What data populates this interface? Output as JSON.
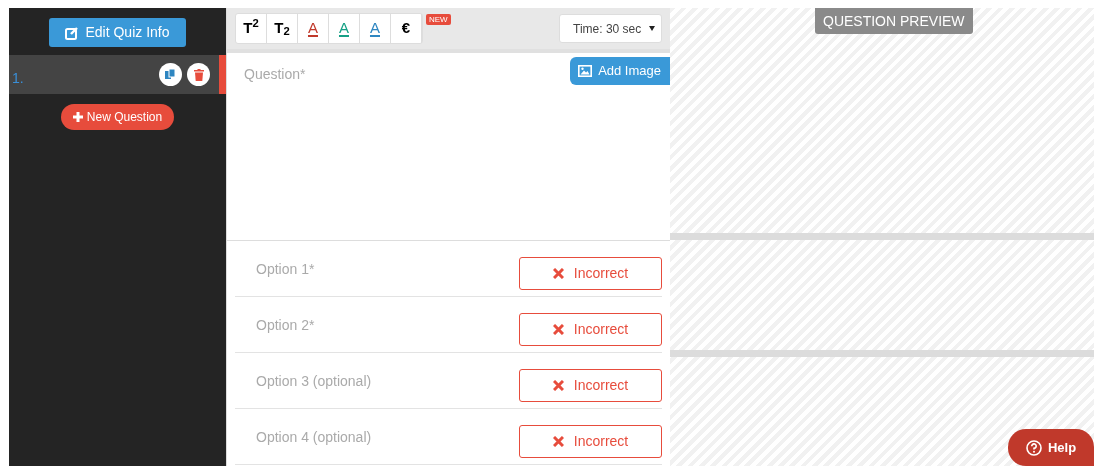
{
  "sidebar": {
    "edit_button": "Edit Quiz Info",
    "questions": [
      {
        "number": "1.",
        "selected": true
      }
    ],
    "new_button": "New Question"
  },
  "toolbar": {
    "buttons": [
      {
        "kind": "text",
        "label": "T$^{2}$"
      },
      {
        "kind": "text",
        "label": "T$_{2}$"
      },
      {
        "kind": "color",
        "label": "A",
        "color": "#c0392b"
      },
      {
        "kind": "color",
        "label": "A",
        "color": "#16a085"
      },
      {
        "kind": "color",
        "label": "A",
        "color": "#2e86c1"
      },
      {
        "kind": "text",
        "label": "€"
      }
    ],
    "badge": "NEW",
    "time_select": "Time: 30 sec"
  },
  "question": {
    "placeholder": "Question*",
    "add_image": "Add Image"
  },
  "options": [
    {
      "placeholder": "Option 1*",
      "correct": false,
      "toggle": "Incorrect"
    },
    {
      "placeholder": "Option 2*",
      "correct": false,
      "toggle": "Incorrect"
    },
    {
      "placeholder": "Option 3 (optional)",
      "correct": false,
      "toggle": "Incorrect"
    },
    {
      "placeholder": "Option 4 (optional)",
      "correct": false,
      "toggle": "Incorrect"
    }
  ],
  "preview": {
    "title": "QUESTION PREVIEW"
  },
  "help_button": "Help"
}
